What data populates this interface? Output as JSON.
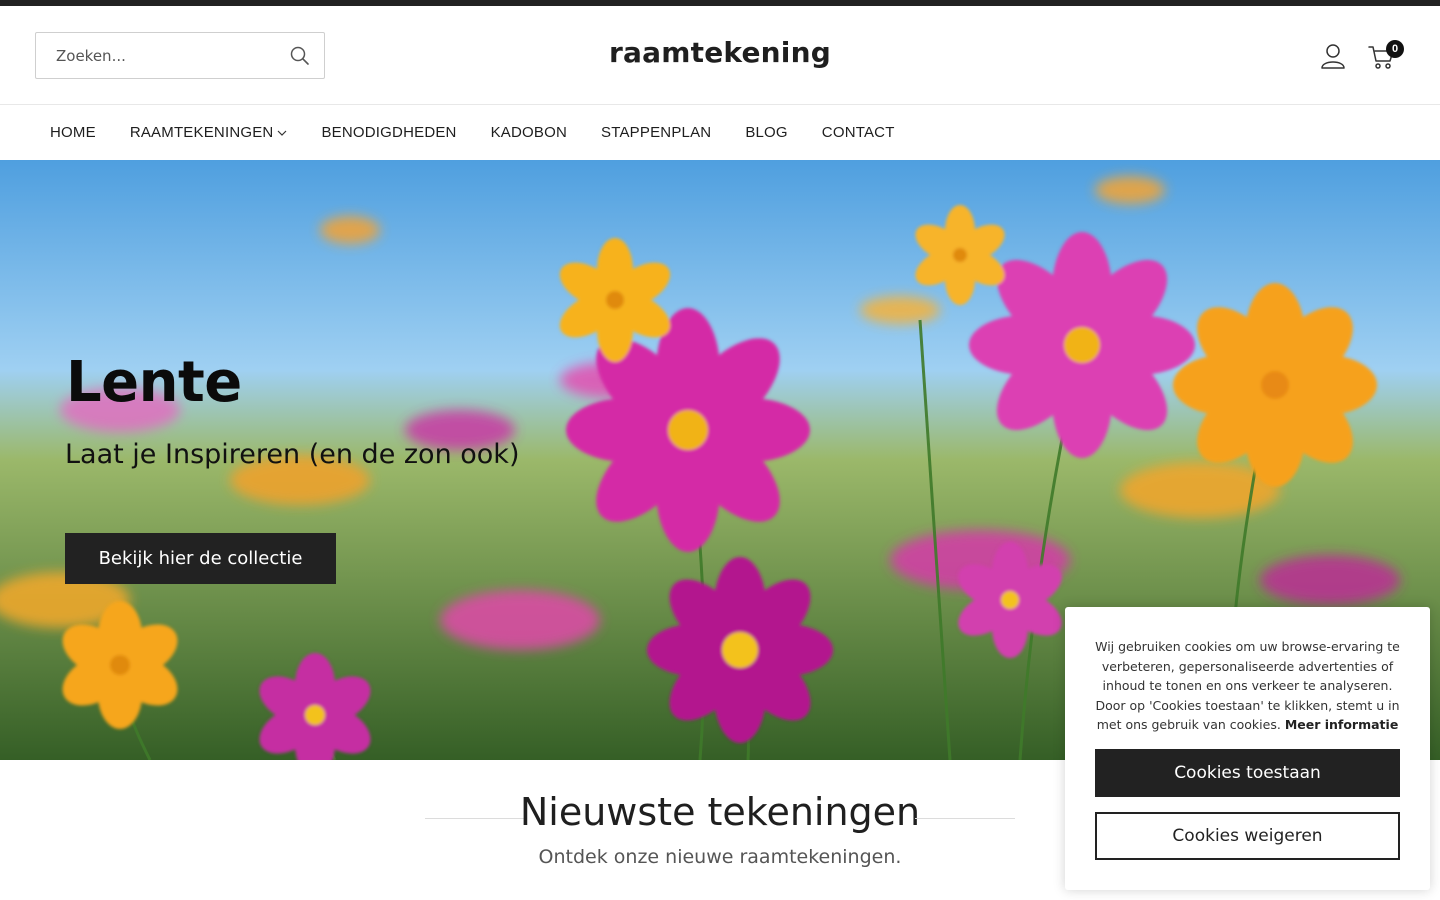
{
  "header": {
    "search_placeholder": "Zoeken...",
    "logo": "raamtekening",
    "cart_count": "0"
  },
  "nav": {
    "items": [
      {
        "label": "HOME"
      },
      {
        "label": "RAAMTEKENINGEN",
        "has_dropdown": true
      },
      {
        "label": "BENODIGDHEDEN"
      },
      {
        "label": "KADOBON"
      },
      {
        "label": "STAPPENPLAN"
      },
      {
        "label": "BLOG"
      },
      {
        "label": "CONTACT"
      }
    ]
  },
  "hero": {
    "title": "Lente",
    "subtitle": "Laat je Inspireren (en de zon ook)",
    "button_label": "Bekijk hier de collectie"
  },
  "section": {
    "title": "Nieuwste tekeningen",
    "subtitle": "Ontdek onze nieuwe raamtekeningen."
  },
  "cookie": {
    "text": "Wij gebruiken cookies om uw browse-ervaring te verbeteren, gepersonaliseerde advertenties of inhoud te tonen en ons verkeer te analyseren. Door op 'Cookies toestaan' te klikken, stemt u in met ons gebruik van cookies.",
    "more_info": "Meer informatie",
    "allow_label": "Cookies toestaan",
    "deny_label": "Cookies weigeren"
  },
  "colors": {
    "dark": "#222222",
    "magenta": "#d21fa6",
    "orange": "#f7a21b",
    "sky": "#7ebde8"
  }
}
